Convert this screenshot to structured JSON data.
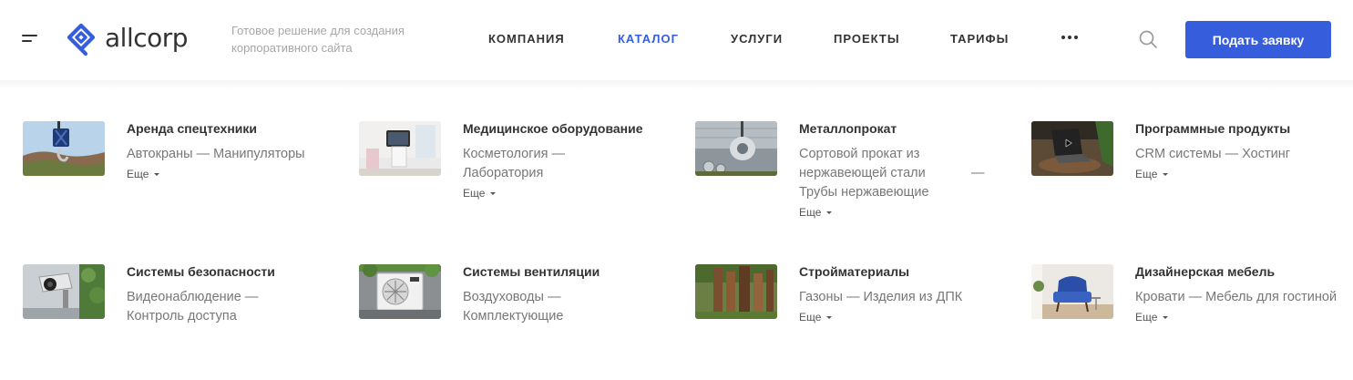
{
  "header": {
    "logo_text": "allcorp",
    "tagline": "Готовое решение для создания корпоративного сайта",
    "nav": [
      {
        "label": "КОМПАНИЯ",
        "active": false
      },
      {
        "label": "КАТАЛОГ",
        "active": true
      },
      {
        "label": "УСЛУГИ",
        "active": false
      },
      {
        "label": "ПРОЕКТЫ",
        "active": false
      },
      {
        "label": "ТАРИФЫ",
        "active": false
      }
    ],
    "more_icon": "more-dots-icon",
    "search_icon": "search-icon",
    "cta_label": "Подать заявку"
  },
  "theme": {
    "accent": "#365edc",
    "text": "#333333",
    "muted": "#777777",
    "tagline": "#a6a6a6"
  },
  "catalog": [
    {
      "title": "Аренда спецтехники",
      "subs": [
        "Автокраны",
        "Манипуляторы"
      ],
      "more": "Еще",
      "thumb": "crane-hook-image"
    },
    {
      "title": "Медицинское оборудование",
      "subs": [
        "Косметология",
        "Лаборатория"
      ],
      "more": "Еще",
      "thumb": "medical-device-image"
    },
    {
      "title": "Металлопрокат",
      "subs": [
        "Сортовой прокат из нержавеющей стали",
        "Трубы нержавеющие"
      ],
      "more": "Еще",
      "thumb": "metal-roll-image"
    },
    {
      "title": "Программные продукты",
      "subs": [
        "CRM системы",
        "Хостинг"
      ],
      "more": "Еще",
      "thumb": "laptop-image"
    },
    {
      "title": "Системы безопасности",
      "subs": [
        "Видеонаблюдение",
        "Контроль доступа"
      ],
      "more": "",
      "thumb": "security-camera-image"
    },
    {
      "title": "Системы вентиляции",
      "subs": [
        "Воздуховоды",
        "Комплектующие"
      ],
      "more": "",
      "thumb": "air-conditioner-image"
    },
    {
      "title": "Стройматериалы",
      "subs": [
        "Газоны",
        "Изделия из ДПК"
      ],
      "more": "Еще",
      "thumb": "wood-boards-image"
    },
    {
      "title": "Дизайнерская мебель",
      "subs": [
        "Кровати",
        "Мебель для гостиной"
      ],
      "more": "Еще",
      "thumb": "armchair-image"
    }
  ]
}
